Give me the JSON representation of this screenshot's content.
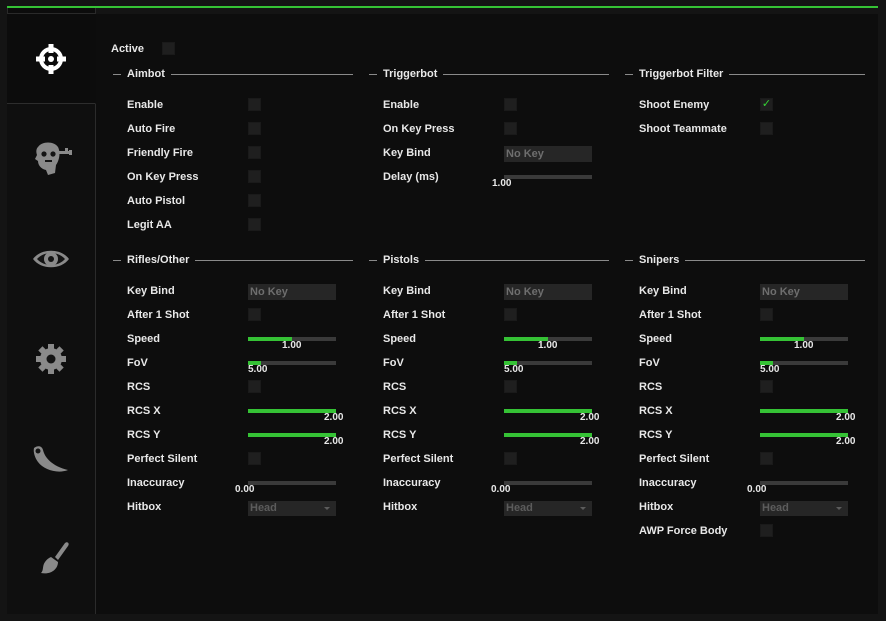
{
  "accent_color": "#35c235",
  "sidebar": {
    "tabs": [
      {
        "icon": "crosshair-icon",
        "active": true
      },
      {
        "icon": "head-key-icon",
        "active": false
      },
      {
        "icon": "eye-icon",
        "active": false
      },
      {
        "icon": "gear-icon",
        "active": false
      },
      {
        "icon": "karambit-knife-icon",
        "active": false
      },
      {
        "icon": "paintbrush-icon",
        "active": false
      }
    ]
  },
  "active": {
    "label": "Active",
    "checked": false
  },
  "aimbot": {
    "title": "Aimbot",
    "rows": [
      {
        "label": "Enable",
        "checked": false
      },
      {
        "label": "Auto Fire",
        "checked": false
      },
      {
        "label": "Friendly Fire",
        "checked": false
      },
      {
        "label": "On Key Press",
        "checked": false
      },
      {
        "label": "Auto Pistol",
        "checked": false
      },
      {
        "label": "Legit AA",
        "checked": false
      }
    ]
  },
  "triggerbot": {
    "title": "Triggerbot",
    "enable": {
      "label": "Enable",
      "checked": false
    },
    "on_key_press": {
      "label": "On Key Press",
      "checked": false
    },
    "key_bind": {
      "label": "Key Bind",
      "value": "No Key"
    },
    "delay": {
      "label": "Delay (ms)",
      "value": "1.00",
      "fraction": 0.0
    }
  },
  "triggerbot_filter": {
    "title": "Triggerbot Filter",
    "shoot_enemy": {
      "label": "Shoot Enemy",
      "checked": true,
      "check_glyph": "✓"
    },
    "shoot_teammate": {
      "label": "Shoot Teammate",
      "checked": false
    }
  },
  "weapons": [
    {
      "title": "Rifles/Other",
      "key_bind": {
        "label": "Key Bind",
        "value": "No Key"
      },
      "after_1_shot": {
        "label": "After 1 Shot",
        "checked": false
      },
      "speed": {
        "label": "Speed",
        "value": "1.00",
        "fraction": 0.5
      },
      "fov": {
        "label": "FoV",
        "value": "5.00",
        "fraction": 0.15
      },
      "rcs": {
        "label": "RCS",
        "checked": false
      },
      "rcs_x": {
        "label": "RCS X",
        "value": "2.00",
        "fraction": 1.0
      },
      "rcs_y": {
        "label": "RCS Y",
        "value": "2.00",
        "fraction": 1.0
      },
      "perfect_silent": {
        "label": "Perfect Silent",
        "checked": false
      },
      "inaccuracy": {
        "label": "Inaccuracy",
        "value": "0.00",
        "fraction": 0.0
      },
      "hitbox": {
        "label": "Hitbox",
        "value": "Head"
      }
    },
    {
      "title": "Pistols",
      "key_bind": {
        "label": "Key Bind",
        "value": "No Key"
      },
      "after_1_shot": {
        "label": "After 1 Shot",
        "checked": false
      },
      "speed": {
        "label": "Speed",
        "value": "1.00",
        "fraction": 0.5
      },
      "fov": {
        "label": "FoV",
        "value": "5.00",
        "fraction": 0.15
      },
      "rcs": {
        "label": "RCS",
        "checked": false
      },
      "rcs_x": {
        "label": "RCS X",
        "value": "2.00",
        "fraction": 1.0
      },
      "rcs_y": {
        "label": "RCS Y",
        "value": "2.00",
        "fraction": 1.0
      },
      "perfect_silent": {
        "label": "Perfect Silent",
        "checked": false
      },
      "inaccuracy": {
        "label": "Inaccuracy",
        "value": "0.00",
        "fraction": 0.0
      },
      "hitbox": {
        "label": "Hitbox",
        "value": "Head"
      }
    },
    {
      "title": "Snipers",
      "key_bind": {
        "label": "Key Bind",
        "value": "No Key"
      },
      "after_1_shot": {
        "label": "After 1 Shot",
        "checked": false
      },
      "speed": {
        "label": "Speed",
        "value": "1.00",
        "fraction": 0.5
      },
      "fov": {
        "label": "FoV",
        "value": "5.00",
        "fraction": 0.15
      },
      "rcs": {
        "label": "RCS",
        "checked": false
      },
      "rcs_x": {
        "label": "RCS X",
        "value": "2.00",
        "fraction": 1.0
      },
      "rcs_y": {
        "label": "RCS Y",
        "value": "2.00",
        "fraction": 1.0
      },
      "perfect_silent": {
        "label": "Perfect Silent",
        "checked": false
      },
      "inaccuracy": {
        "label": "Inaccuracy",
        "value": "0.00",
        "fraction": 0.0
      },
      "hitbox": {
        "label": "Hitbox",
        "value": "Head"
      },
      "awp_force_body": {
        "label": "AWP Force Body",
        "checked": false
      }
    }
  ]
}
